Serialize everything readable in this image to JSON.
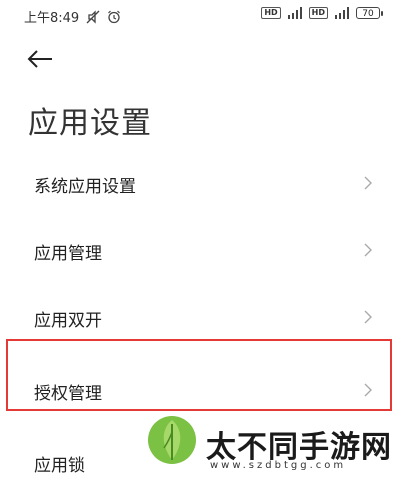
{
  "status_bar": {
    "time": "上午8:49",
    "icons_left": [
      "mute-icon",
      "alarm-icon"
    ],
    "sim1_badge": "HD",
    "sim2_badge": "HD",
    "network_label": "4G",
    "battery": "70"
  },
  "header": {
    "back_icon": "arrow-left-icon",
    "title": "应用设置"
  },
  "list": {
    "items": [
      {
        "label": "系统应用设置"
      },
      {
        "label": "应用管理"
      },
      {
        "label": "应用双开"
      },
      {
        "label": "授权管理"
      },
      {
        "label": "应用锁"
      }
    ]
  },
  "highlight": {
    "color": "#e53935",
    "target": "授权管理"
  },
  "watermark": {
    "text": "太不同手游网",
    "site": "www.szdbtgg.com"
  }
}
